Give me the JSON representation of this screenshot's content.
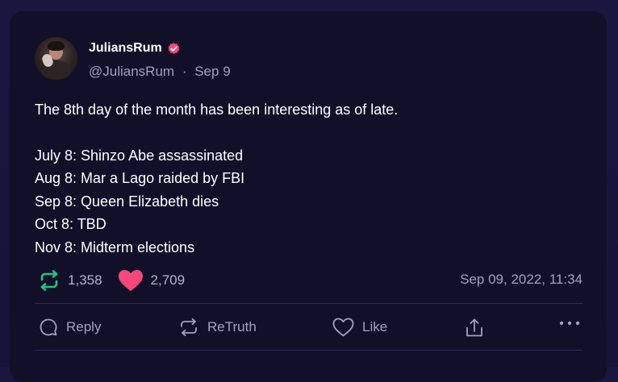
{
  "post": {
    "author": {
      "name": "JuliansRum",
      "handle": "@JuliansRum",
      "date_short": "Sep 9",
      "separator": "·"
    },
    "lines": [
      "The 8th day of the month has been interesting as of late.",
      "July 8: Shinzo Abe assassinated",
      "Aug 8: Mar a Lago raided by FBI",
      "Sep 8: Queen Elizabeth dies",
      "Oct 8: TBD",
      "Nov 8: Midterm elections"
    ],
    "stats": {
      "retruths": "1,358",
      "likes": "2,709"
    },
    "timestamp": "Sep 09, 2022, 11:34"
  },
  "actions": {
    "reply": "Reply",
    "retruth": "ReTruth",
    "like": "Like"
  },
  "colors": {
    "verified": "#f6487a",
    "retruth_green": "#23c47a",
    "heart_pink": "#f6487a",
    "card_bg": "#121029",
    "page_bg": "#1a1640"
  },
  "icons": {
    "verified": "verified-badge-icon",
    "retruth": "retruth-arrows-icon",
    "heart": "heart-icon",
    "reply": "speech-bubble-icon",
    "share": "share-upload-icon",
    "more": "more-dots-icon"
  }
}
